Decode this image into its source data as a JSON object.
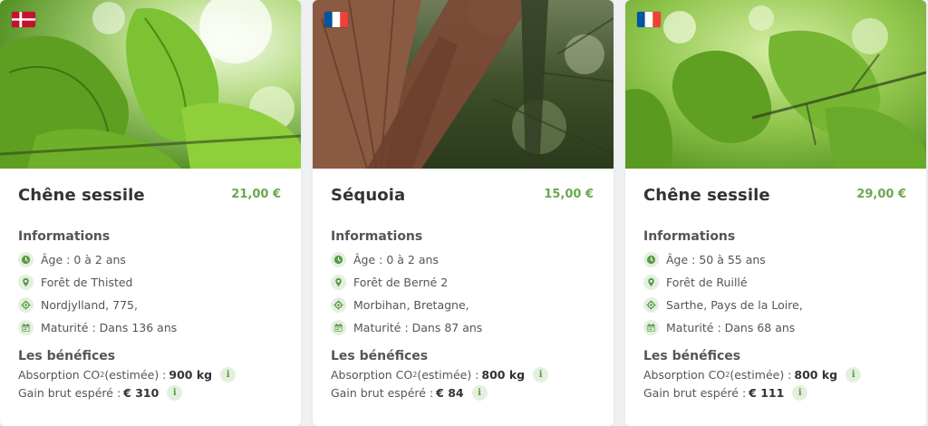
{
  "colors": {
    "accent_green": "#6aa84f",
    "icon_bg": "#e4f0df",
    "text": "#555555",
    "title": "#333333"
  },
  "labels": {
    "informations": "Informations",
    "benefits": "Les bénéfices",
    "co2_prefix": "Absorption CO",
    "co2_sub": "2",
    "co2_suffix": " (estimée) :",
    "gain_prefix": "Gain brut espéré :",
    "info_glyph": "i"
  },
  "cards": [
    {
      "flag": "denmark-flag-icon",
      "photo": "oak-leaves-photo",
      "title": "Chêne sessile",
      "price": "21,00 €",
      "age": "Âge : 0 à 2 ans",
      "forest": "Forêt de Thisted",
      "location": "Nordjylland, 775,",
      "maturity": "Maturité : Dans 136 ans",
      "co2_value": "900 kg",
      "gain_value": "€ 310"
    },
    {
      "flag": "france-flag-icon",
      "photo": "sequoia-trunks-photo",
      "title": "Séquoia",
      "price": "15,00 €",
      "age": "Âge : 0 à 2 ans",
      "forest": "Forêt de Berné 2",
      "location": "Morbihan, Bretagne,",
      "maturity": "Maturité : Dans 87 ans",
      "co2_value": "800 kg",
      "gain_value": "€ 84"
    },
    {
      "flag": "france-flag-icon",
      "photo": "oak-branch-photo",
      "title": "Chêne sessile",
      "price": "29,00 €",
      "age": "Âge : 50 à 55 ans",
      "forest": "Forêt de Ruillé",
      "location": "Sarthe, Pays de la Loire,",
      "maturity": "Maturité : Dans 68 ans",
      "co2_value": "800 kg",
      "gain_value": "€ 111"
    }
  ]
}
